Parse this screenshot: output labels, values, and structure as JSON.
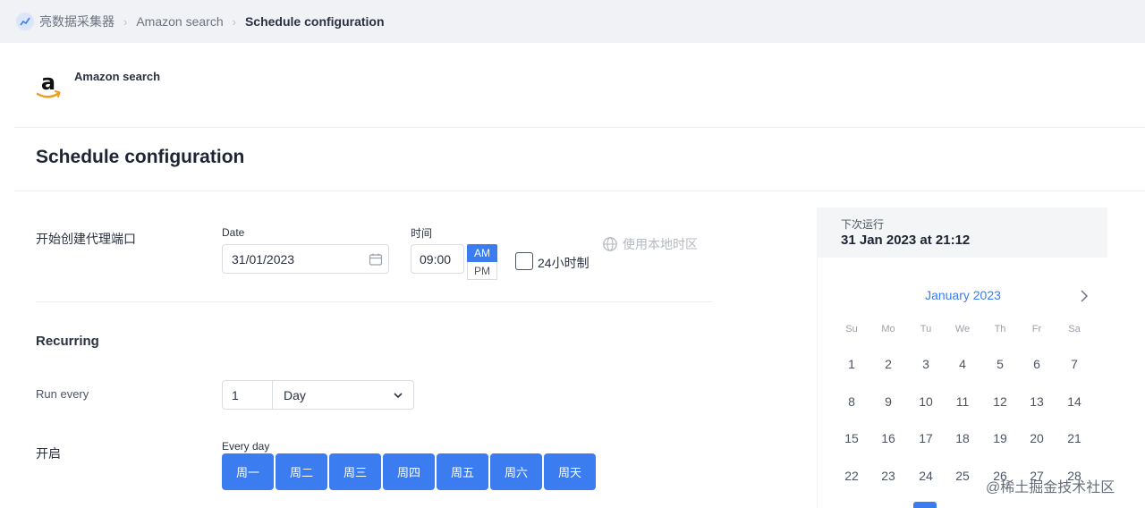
{
  "breadcrumb": {
    "items": [
      "亮数据采集器",
      "Amazon search",
      "Schedule configuration"
    ]
  },
  "scraper": {
    "name": "Amazon search",
    "logo": "amazon-logo"
  },
  "page": {
    "title": "Schedule configuration"
  },
  "start": {
    "label": "开始创建代理端口",
    "date_label": "Date",
    "date_value": "31/01/2023",
    "time_label": "时间",
    "time_value": "09:00",
    "am": "AM",
    "pm": "PM",
    "selected_period": "AM",
    "use_24h_label": "24小时制",
    "use_24h_checked": false,
    "local_tz_label": "使用本地时区"
  },
  "recurring": {
    "title": "Recurring",
    "run_every_label": "Run every",
    "interval_value": "1",
    "interval_unit": "Day",
    "on_label": "开启",
    "every_day_label": "Every day",
    "days": [
      "周一",
      "周二",
      "周三",
      "周四",
      "周五",
      "周六",
      "周天"
    ]
  },
  "next_run": {
    "label": "下次运行",
    "value": "31 Jan 2023 at 21:12"
  },
  "calendar": {
    "month": "January 2023",
    "weekdays": [
      "Su",
      "Mo",
      "Tu",
      "We",
      "Th",
      "Fr",
      "Sa"
    ],
    "weeks": [
      [
        "1",
        "2",
        "3",
        "4",
        "5",
        "6",
        "7"
      ],
      [
        "8",
        "9",
        "10",
        "11",
        "12",
        "13",
        "14"
      ],
      [
        "15",
        "16",
        "17",
        "18",
        "19",
        "20",
        "21"
      ],
      [
        "22",
        "23",
        "24",
        "25",
        "26",
        "27",
        "28"
      ]
    ]
  },
  "watermark": "@稀土掘金技术社区",
  "colors": {
    "accent": "#3b7cf0",
    "topbar": "#f1f2f5",
    "panel": "#f4f5f7"
  }
}
